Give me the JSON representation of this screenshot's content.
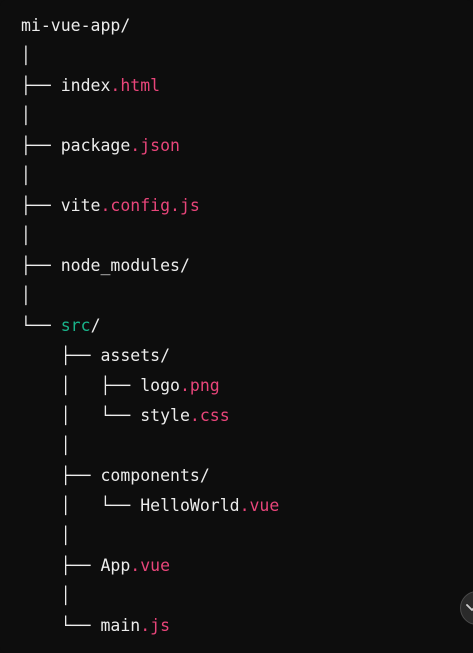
{
  "colors": {
    "background": "#0d0d0d",
    "text": "#ececec",
    "extension": "#e8457a",
    "highlight_dir": "#19b38a"
  },
  "tree": [
    {
      "prefix": "",
      "name": "mi-vue-app",
      "ext": "",
      "suffix": "/",
      "style": "plain"
    },
    {
      "prefix": "│",
      "name": "",
      "ext": "",
      "suffix": "",
      "style": "plain"
    },
    {
      "prefix": "├── ",
      "name": "index",
      "ext": ".html",
      "suffix": "",
      "style": "plain"
    },
    {
      "prefix": "│",
      "name": "",
      "ext": "",
      "suffix": "",
      "style": "plain"
    },
    {
      "prefix": "├── ",
      "name": "package",
      "ext": ".json",
      "suffix": "",
      "style": "plain"
    },
    {
      "prefix": "│",
      "name": "",
      "ext": "",
      "suffix": "",
      "style": "plain"
    },
    {
      "prefix": "├── ",
      "name": "vite",
      "ext": ".config.js",
      "suffix": "",
      "style": "plain"
    },
    {
      "prefix": "│",
      "name": "",
      "ext": "",
      "suffix": "",
      "style": "plain"
    },
    {
      "prefix": "├── ",
      "name": "node_modules",
      "ext": "",
      "suffix": "/",
      "style": "plain"
    },
    {
      "prefix": "│",
      "name": "",
      "ext": "",
      "suffix": "",
      "style": "plain"
    },
    {
      "prefix": "└── ",
      "name": "src",
      "ext": "",
      "suffix": "/",
      "style": "highlight"
    },
    {
      "prefix": "    ├── ",
      "name": "assets",
      "ext": "",
      "suffix": "/",
      "style": "plain"
    },
    {
      "prefix": "    │   ├── ",
      "name": "logo",
      "ext": ".png",
      "suffix": "",
      "style": "plain"
    },
    {
      "prefix": "    │   └── ",
      "name": "style",
      "ext": ".css",
      "suffix": "",
      "style": "plain"
    },
    {
      "prefix": "    │",
      "name": "",
      "ext": "",
      "suffix": "",
      "style": "plain"
    },
    {
      "prefix": "    ├── ",
      "name": "components",
      "ext": "",
      "suffix": "/",
      "style": "plain"
    },
    {
      "prefix": "    │   └── ",
      "name": "HelloWorld",
      "ext": ".vue",
      "suffix": "",
      "style": "plain"
    },
    {
      "prefix": "    │",
      "name": "",
      "ext": "",
      "suffix": "",
      "style": "plain"
    },
    {
      "prefix": "    ├── ",
      "name": "App",
      "ext": ".vue",
      "suffix": "",
      "style": "plain"
    },
    {
      "prefix": "    │",
      "name": "",
      "ext": "",
      "suffix": "",
      "style": "plain"
    },
    {
      "prefix": "    └── ",
      "name": "main",
      "ext": ".js",
      "suffix": "",
      "style": "plain"
    }
  ],
  "scroll_button": {
    "icon": "chevron-down-icon"
  }
}
